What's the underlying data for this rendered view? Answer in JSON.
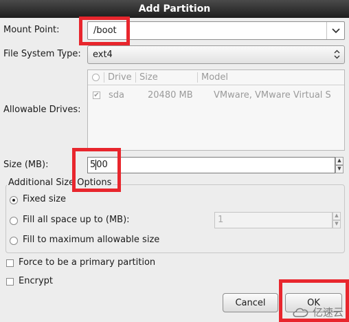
{
  "dialog": {
    "title": "Add Partition"
  },
  "mount_point": {
    "label": "Mount Point:",
    "value": "/boot"
  },
  "fs_type": {
    "label": "File System Type:",
    "value": "ext4"
  },
  "drives": {
    "label": "Allowable Drives:",
    "columns": [
      "Drive",
      "Size",
      "Model"
    ],
    "rows": [
      {
        "checked": true,
        "drive": "sda",
        "size": "20480 MB",
        "model": "VMware, VMware Virtual S"
      }
    ]
  },
  "size": {
    "label": "Size (MB):",
    "value": "500",
    "value_before_cursor": "5",
    "value_after_cursor": "00"
  },
  "additional": {
    "title": "Additional Size Options",
    "options": [
      {
        "label": "Fixed size",
        "selected": true
      },
      {
        "label": "Fill all space up to (MB):",
        "selected": false
      },
      {
        "label": "Fill to maximum allowable size",
        "selected": false
      }
    ],
    "fill_value": "1"
  },
  "primary": {
    "label": "Force to be a primary partition",
    "checked": false
  },
  "encrypt": {
    "label": "Encrypt",
    "checked": false
  },
  "buttons": {
    "cancel": "Cancel",
    "ok": "OK"
  },
  "watermark": {
    "text": "亿速云"
  },
  "colors": {
    "highlight": "#e8262d",
    "titlebar": "#1e1e1e"
  }
}
